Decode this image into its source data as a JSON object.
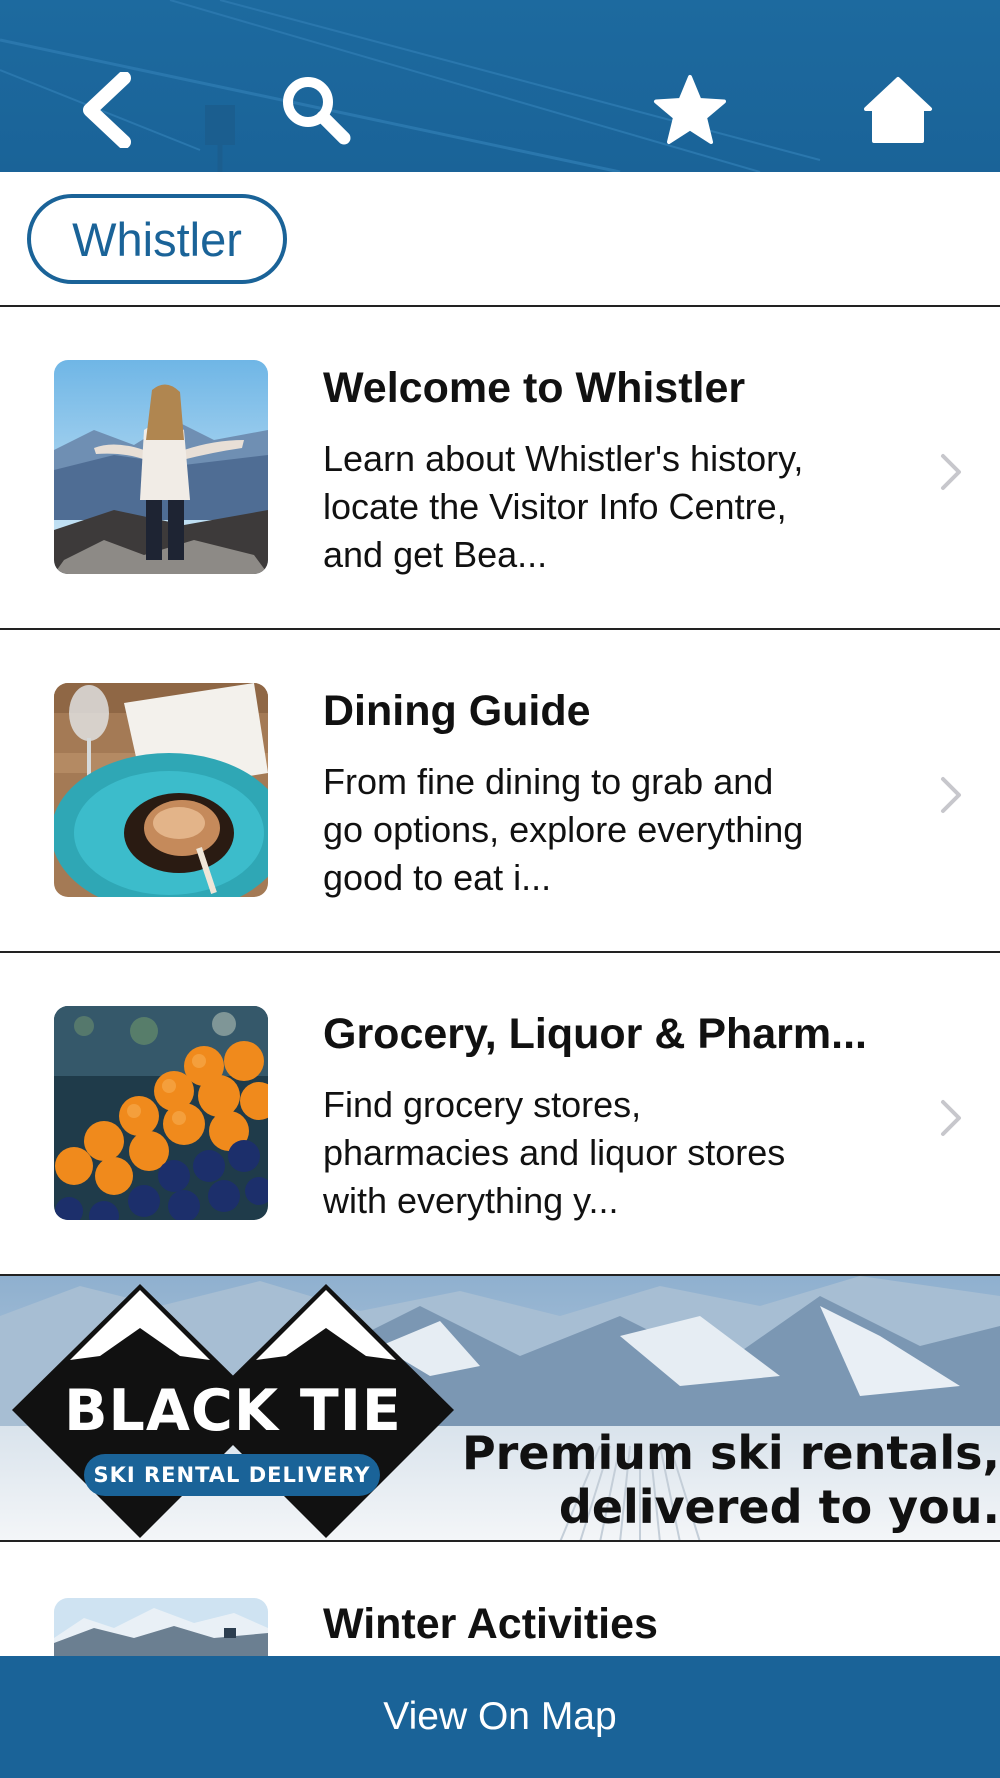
{
  "nav": {
    "back_icon": "chevron-left-icon",
    "search_icon": "search-icon",
    "favorites_icon": "star-icon",
    "home_icon": "home-icon",
    "bar_color": "#1a6398"
  },
  "location_chip": {
    "label": "Whistler"
  },
  "items": [
    {
      "title": "Welcome to Whistler",
      "description": "Learn about Whistler's history, locate the Visitor Info Centre, and get Bea...",
      "image": "person-on-mountain-summit"
    },
    {
      "title": "Dining Guide",
      "description": "From fine dining to grab and go options, explore everything good to eat i...",
      "image": "plated-pork-chop-with-wine"
    },
    {
      "title": "Grocery, Liquor & Pharm...",
      "description": "Find grocery stores, pharmacies and liquor stores with everything y...",
      "image": "oranges-and-blueberries"
    }
  ],
  "ad": {
    "brand": "BLACK TIE",
    "brand_sub": "SKI RENTAL DELIVERY",
    "tagline_line1": "Premium ski rentals,",
    "tagline_line2": "delivered to you."
  },
  "partial_item": {
    "title": "Winter Activities",
    "image": "snowy-mountain-range"
  },
  "bottom_bar": {
    "label": "View On Map"
  },
  "colors": {
    "accent": "#1a6398",
    "divider": "#222222",
    "chevron": "#c7c7cc"
  }
}
